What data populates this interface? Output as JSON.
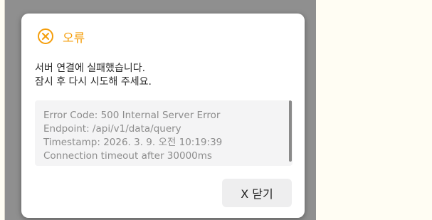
{
  "colors": {
    "accent": "#f59e0b",
    "backdrop": "#8f8f8f",
    "page_background": "#fffdf3"
  },
  "dialog": {
    "icon": "error-circle-x-icon",
    "title": "오류",
    "message_lines": [
      "서버 연결에 실패했습니다.",
      "잠시 후 다시 시도해 주세요."
    ],
    "details_lines": [
      "Error Code: 500 Internal Server Error",
      "Endpoint: /api/v1/data/query",
      "Timestamp: 2026. 3. 9. 오전 10:19:39",
      "Connection timeout after 30000ms"
    ],
    "close_button_label": "X 닫기"
  }
}
